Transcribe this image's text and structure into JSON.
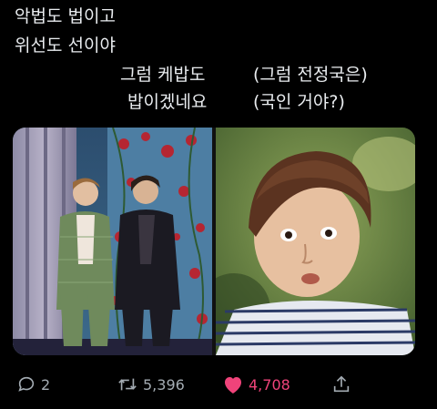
{
  "tweet": {
    "lines": [
      "악법도 법이고",
      "위선도 선이야",
      "그럼 케밥도",
      "밥이겠네요",
      "(그럼 전정국은)",
      "(국인 거야?)"
    ]
  },
  "actions": {
    "reply_count": "2",
    "retweet_count": "5,396",
    "like_count": "4,708"
  },
  "icons": {
    "reply": "reply-bubble-icon",
    "retweet": "retweet-arrows-icon",
    "like": "heart-icon",
    "share": "share-upload-icon"
  },
  "colors": {
    "background": "#000000",
    "text": "#e9ecef",
    "muted": "#a4acb3",
    "like_accent": "#f0437a"
  }
}
